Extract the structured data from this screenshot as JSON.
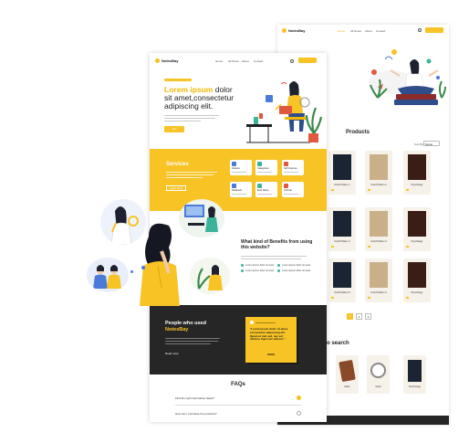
{
  "back_page": {
    "brand": "NotesBay",
    "nav": [
      "Home",
      "All Notes",
      "About",
      "Contact"
    ],
    "search_placeholder": "",
    "login_label": "",
    "products_heading": "Products",
    "sort_label": "Sort By",
    "sort_value": "Name",
    "products": [
      {
        "title": "Oval Problem 1",
        "cover": "dark"
      },
      {
        "title": "Oval Problem 2",
        "cover": "card"
      },
      {
        "title": "Psychology",
        "cover": "red"
      },
      {
        "title": "Oval Problem 3",
        "cover": "dark"
      },
      {
        "title": "Oval Problem 4",
        "cover": "card"
      },
      {
        "title": "Psychology",
        "cover": "red"
      },
      {
        "title": "Oval Problem 5",
        "cover": "dark"
      },
      {
        "title": "Oval Problem 6",
        "cover": "card"
      },
      {
        "title": "Psychology",
        "cover": "red"
      }
    ],
    "pagination": [
      "1",
      "2",
      "3"
    ],
    "search_heading": "to search",
    "search_items": [
      {
        "title": "Alarm"
      },
      {
        "title": "Clock"
      },
      {
        "title": "Psychology"
      }
    ]
  },
  "front_page": {
    "brand": "NotesBay",
    "nav": [
      "Home",
      "All Notes",
      "About",
      "Contact"
    ],
    "hero": {
      "title_highlight": "Lorem ipsum",
      "title_rest": "dolor sit amet,consectetur adipiscing elit.",
      "cta": "Get"
    },
    "services": {
      "heading": "Services",
      "button": "Learn More",
      "cards": [
        {
          "label": "Feature",
          "color": "#4a7bd8"
        },
        {
          "label": "Categories",
          "color": "#3bb39a"
        },
        {
          "label": "Self Improve",
          "color": "#e2583e"
        },
        {
          "label": "Notebook",
          "color": "#4a7bd8"
        },
        {
          "label": "Find Notes",
          "color": "#3bb39a"
        },
        {
          "label": "Tutorial",
          "color": "#e2583e"
        }
      ]
    },
    "benefits": {
      "heading": "What kind of Benefits from using this website?",
      "points": [
        "Lorem ipsum dolor sit amet",
        "Lorem ipsum dolor sit amet",
        "Lorem ipsum dolor sit amet",
        "Lorem ipsum dolor sit amet"
      ]
    },
    "testimonials": {
      "heading_white": "People who used",
      "heading_yellow": "NotesBay",
      "link": "Read more",
      "quote": "\"Lorem ipsum dolor sit amet, consectetur adipiscing elit. Quam ut nisl sed, nec est ultrices. Eget nec ultrices.\""
    },
    "faqs": {
      "heading": "FAQs",
      "questions": [
        "Find the right information faster?",
        "How can I purchase the products?"
      ]
    }
  },
  "colors": {
    "accent": "#f7c325",
    "dark_section": "#262626",
    "services_bg": "#f7c325",
    "icon_blue": "#4a7bd8",
    "icon_green": "#3bb39a",
    "icon_red": "#e2583e"
  }
}
